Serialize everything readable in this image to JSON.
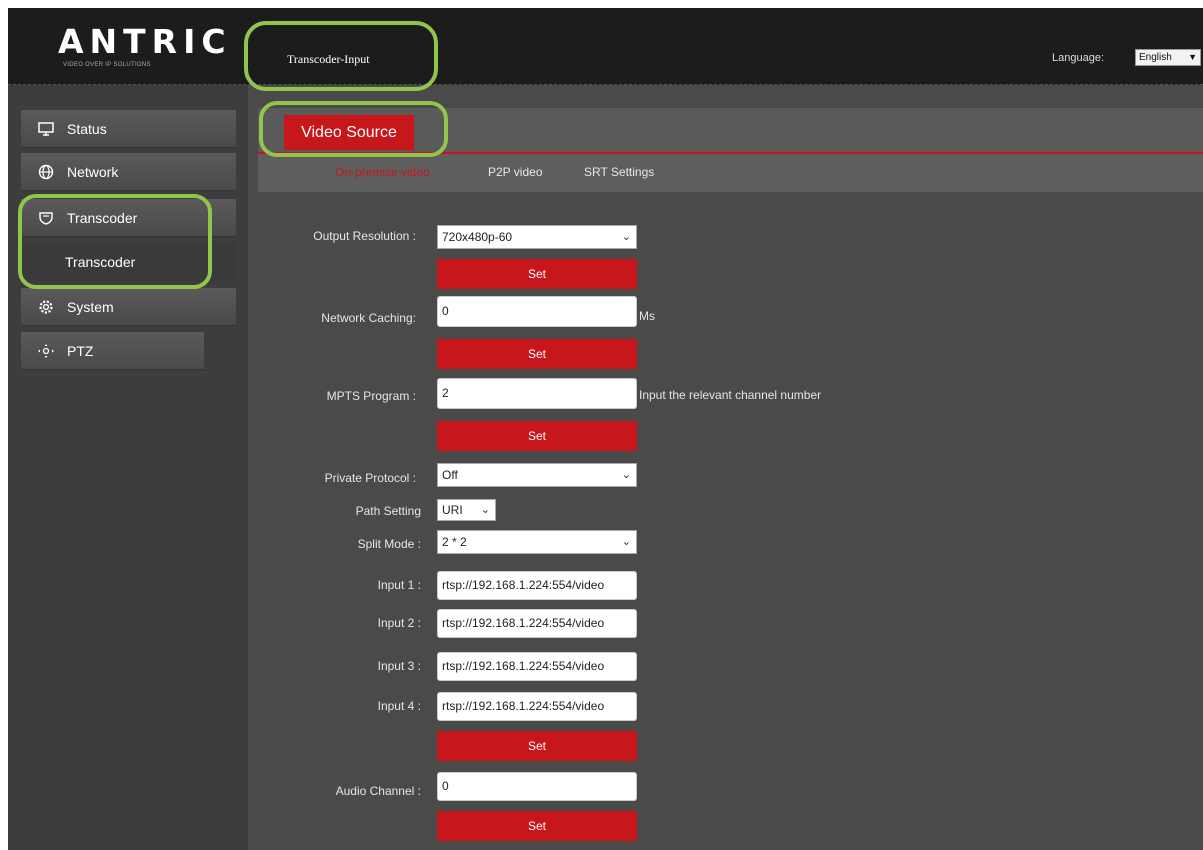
{
  "header": {
    "logo_text": "ANTRIC",
    "logo_tagline": "VIDEO OVER IP SOLUTIONS",
    "page_title": "Transcoder-Input",
    "language_label": "Language:",
    "language_value": "English"
  },
  "sidebar": {
    "items": [
      {
        "label": "Status",
        "icon": "monitor-icon"
      },
      {
        "label": "Network",
        "icon": "globe-icon"
      },
      {
        "label": "Transcoder",
        "icon": "shield-icon"
      },
      {
        "label": "Transcoder",
        "icon": ""
      },
      {
        "label": "System",
        "icon": "gear-icon"
      },
      {
        "label": "PTZ",
        "icon": "ptz-icon"
      }
    ]
  },
  "tabs": {
    "main": "Video Source",
    "sub": [
      "On-premise video",
      "P2P video",
      "SRT Settings"
    ]
  },
  "form": {
    "output_resolution": {
      "label": "Output Resolution :",
      "value": "720x480p-60",
      "button": "Set"
    },
    "network_caching": {
      "label": "Network Caching:",
      "value": "0",
      "unit": "Ms",
      "button": "Set"
    },
    "mpts_program": {
      "label": "MPTS Program :",
      "value": "2",
      "hint": "Input the relevant channel number",
      "button": "Set"
    },
    "private_protocol": {
      "label": "Private Protocol :",
      "value": "Off"
    },
    "path_setting": {
      "label": "Path Setting",
      "value": "URI"
    },
    "split_mode": {
      "label": "Split Mode :",
      "value": "2 * 2"
    },
    "inputs": [
      {
        "label": "Input 1 :",
        "value": "rtsp://192.168.1.224:554/video"
      },
      {
        "label": "Input 2 :",
        "value": "rtsp://192.168.1.224:554/video"
      },
      {
        "label": "Input 3 :",
        "value": "rtsp://192.168.1.224:554/video"
      },
      {
        "label": "Input 4 :",
        "value": "rtsp://192.168.1.224:554/video"
      }
    ],
    "inputs_button": "Set",
    "audio_channel": {
      "label": "Audio Channel :",
      "value": "0",
      "button": "Set"
    }
  },
  "colors": {
    "accent_red": "#c8161d",
    "highlight_green": "#93c44b",
    "active_subtab": "#c8161d"
  }
}
